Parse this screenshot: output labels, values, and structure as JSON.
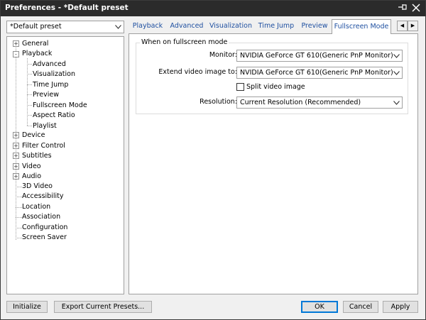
{
  "window": {
    "title": "Preferences - *Default preset"
  },
  "preset": {
    "selected": "*Default preset"
  },
  "tree": {
    "items": [
      {
        "label": "General",
        "level": 0,
        "expander": "+"
      },
      {
        "label": "Playback",
        "level": 0,
        "expander": "-"
      },
      {
        "label": "Advanced",
        "level": 1
      },
      {
        "label": "Visualization",
        "level": 1
      },
      {
        "label": "Time Jump",
        "level": 1
      },
      {
        "label": "Preview",
        "level": 1
      },
      {
        "label": "Fullscreen Mode",
        "level": 1
      },
      {
        "label": "Aspect Ratio",
        "level": 1
      },
      {
        "label": "Playlist",
        "level": 1
      },
      {
        "label": "Device",
        "level": 0,
        "expander": "+"
      },
      {
        "label": "Filter Control",
        "level": 0,
        "expander": "+"
      },
      {
        "label": "Subtitles",
        "level": 0,
        "expander": "+"
      },
      {
        "label": "Video",
        "level": 0,
        "expander": "+"
      },
      {
        "label": "Audio",
        "level": 0,
        "expander": "+"
      },
      {
        "label": "3D Video",
        "level": 0
      },
      {
        "label": "Accessibility",
        "level": 0
      },
      {
        "label": "Location",
        "level": 0
      },
      {
        "label": "Association",
        "level": 0
      },
      {
        "label": "Configuration",
        "level": 0
      },
      {
        "label": "Screen Saver",
        "level": 0
      }
    ]
  },
  "tabs": [
    {
      "label": "Playback"
    },
    {
      "label": "Advanced"
    },
    {
      "label": "Visualization"
    },
    {
      "label": "Time Jump"
    },
    {
      "label": "Preview"
    },
    {
      "label": "Fullscreen Mode",
      "active": true
    }
  ],
  "fullscreen": {
    "group_title": "When on fullscreen mode",
    "monitor_label": "Monitor:",
    "monitor_value": "NVIDIA GeForce GT 610(Generic PnP Monitor)",
    "extend_label": "Extend video image to:",
    "extend_value": "NVIDIA GeForce GT 610(Generic PnP Monitor)",
    "split_label": "Split video image",
    "split_checked": false,
    "resolution_label": "Resolution:",
    "resolution_value": "Current Resolution (Recommended)"
  },
  "buttons": {
    "initialize": "Initialize",
    "export": "Export Current Presets...",
    "ok": "OK",
    "cancel": "Cancel",
    "apply": "Apply"
  }
}
